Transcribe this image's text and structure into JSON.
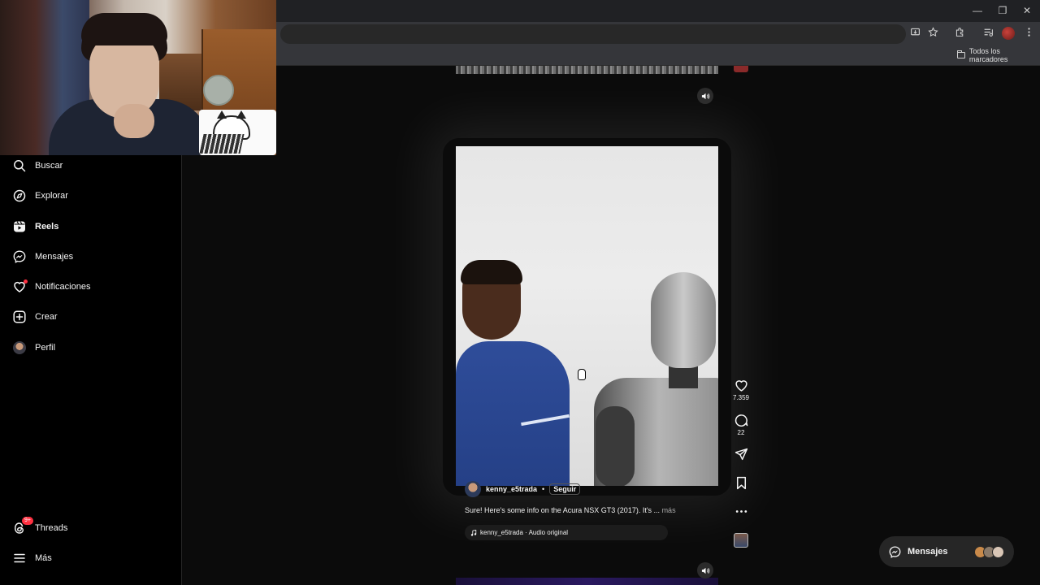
{
  "browser": {
    "bookmarks_label": "Todos los marcadores",
    "window_controls": {
      "minimize": "—",
      "restore": "❐",
      "close": "✕"
    }
  },
  "sidebar": {
    "items": [
      {
        "label": "Buscar",
        "icon": "search-icon"
      },
      {
        "label": "Explorar",
        "icon": "compass-icon"
      },
      {
        "label": "Reels",
        "icon": "reels-icon",
        "active": true
      },
      {
        "label": "Mensajes",
        "icon": "messenger-icon"
      },
      {
        "label": "Notificaciones",
        "icon": "heart-icon"
      },
      {
        "label": "Crear",
        "icon": "plus-square-icon"
      },
      {
        "label": "Perfil",
        "icon": "avatar"
      }
    ],
    "bottom": [
      {
        "label": "Threads",
        "icon": "threads-icon",
        "badge": "9+"
      },
      {
        "label": "Más",
        "icon": "menu-icon"
      }
    ]
  },
  "reel": {
    "author": "kenny_e5trada",
    "separator": "•",
    "follow_label": "Seguir",
    "caption": "Sure! Here's some info on the Acura NSX GT3 (2017). It's ...",
    "caption_more": "más",
    "audio": "kenny_e5trada · Audio original",
    "likes": "7.359",
    "comments": "22"
  },
  "messages_pill": {
    "label": "Mensajes"
  },
  "colors": {
    "accent_red": "#ff3040",
    "background": "#000000",
    "panel": "#262626"
  }
}
